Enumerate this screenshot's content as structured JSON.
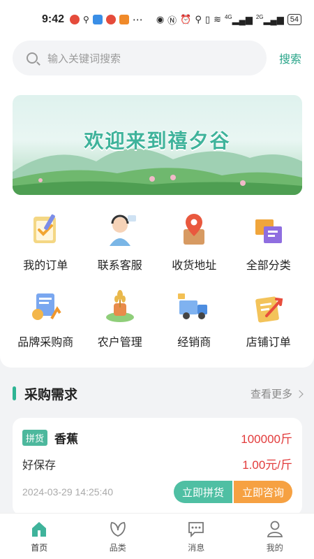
{
  "status_bar": {
    "time": "9:42",
    "battery": "54",
    "net_4g": "4G",
    "net_2g": "2G"
  },
  "search": {
    "placeholder": "输入关键词搜索",
    "button": "搜索"
  },
  "banner": {
    "title": "欢迎来到禧夕谷"
  },
  "grid": [
    {
      "label": "我的订单",
      "icon": "order-checklist-icon"
    },
    {
      "label": "联系客服",
      "icon": "customer-service-icon"
    },
    {
      "label": "收货地址",
      "icon": "location-pin-icon"
    },
    {
      "label": "全部分类",
      "icon": "category-boxes-icon"
    },
    {
      "label": "品牌采购商",
      "icon": "brand-buyer-icon"
    },
    {
      "label": "农户管理",
      "icon": "farmer-wheat-icon"
    },
    {
      "label": "经销商",
      "icon": "delivery-truck-icon"
    },
    {
      "label": "店铺订单",
      "icon": "shop-order-icon"
    }
  ],
  "section": {
    "title": "采购需求",
    "more": "查看更多"
  },
  "card": {
    "tag": "拼货",
    "product": "香蕉",
    "quantity": "100000斤",
    "spec": "好保存",
    "price": "1.00元/斤",
    "date": "2024-03-29 14:25:40",
    "btn_join": "立即拼货",
    "btn_consult": "立即咨询"
  },
  "tabs": [
    {
      "label": "首页",
      "icon": "home-icon",
      "active": true
    },
    {
      "label": "品类",
      "icon": "leaf-icon",
      "active": false
    },
    {
      "label": "消息",
      "icon": "message-icon",
      "active": false
    },
    {
      "label": "我的",
      "icon": "profile-icon",
      "active": false
    }
  ],
  "colors": {
    "accent": "#2aa58a",
    "price": "#e23b3b",
    "orange": "#f6a142"
  }
}
